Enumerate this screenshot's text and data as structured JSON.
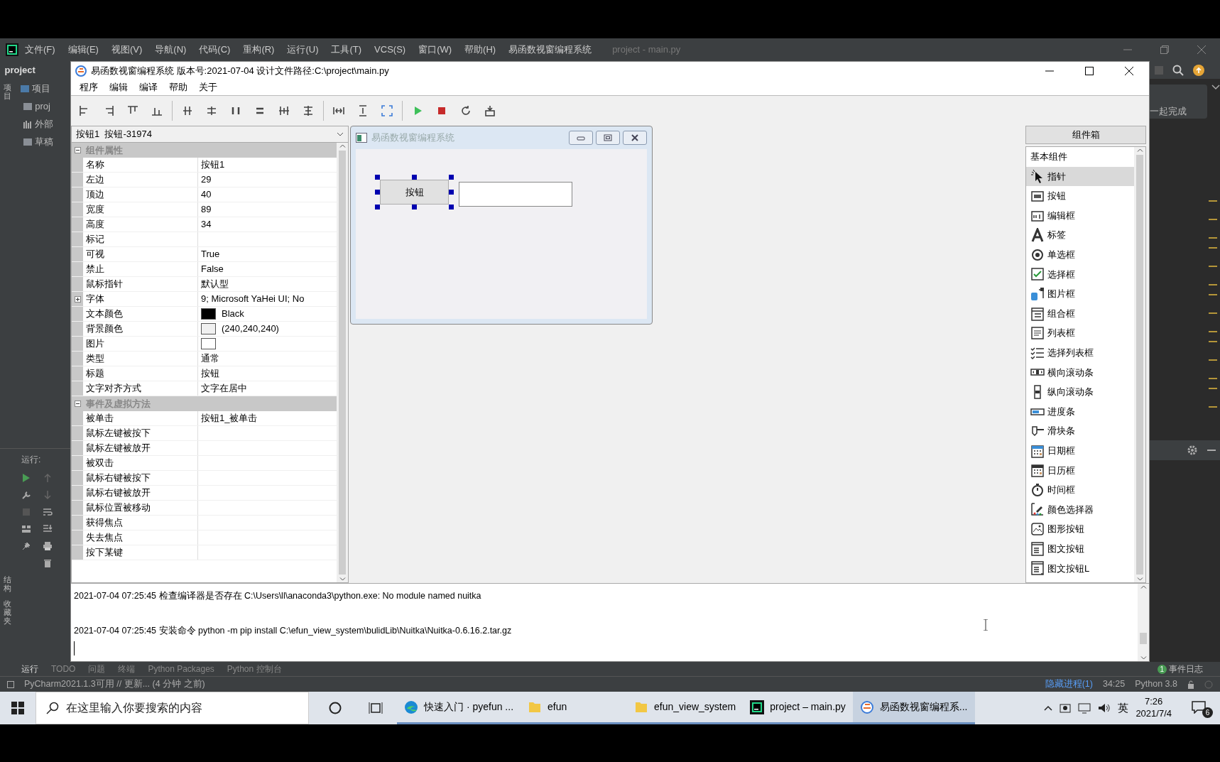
{
  "ide": {
    "menu": [
      "文件(F)",
      "编辑(E)",
      "视图(V)",
      "导航(N)",
      "代码(C)",
      "重构(R)",
      "运行(U)",
      "工具(T)",
      "VCS(S)",
      "窗口(W)",
      "帮助(H)",
      "易函数视窗编程系统"
    ],
    "project_title": "project - main.py",
    "breadcrumb": "project",
    "tool_tab": "项目",
    "tree": [
      {
        "label": "项目"
      },
      {
        "label": "proj"
      },
      {
        "label": "外部"
      },
      {
        "label": "草稿"
      }
    ],
    "run_label": "运行:",
    "side_tabs": [
      "结构",
      "收藏夹"
    ],
    "notice": "一起完成",
    "bottom_tabs": [
      {
        "label": "运行",
        "selected": true
      },
      {
        "label": "TODO",
        "selected": false
      },
      {
        "label": "问题",
        "selected": false
      },
      {
        "label": "终端",
        "selected": false
      },
      {
        "label": "Python Packages",
        "selected": false
      },
      {
        "label": "Python 控制台",
        "selected": false
      }
    ],
    "event_log": {
      "label": "事件日志",
      "count": "1"
    },
    "status": {
      "message": "PyCharm2021.1.3可用 // 更新... (4 分钟 之前)",
      "link": "隐藏进程(1)",
      "position": "34:25",
      "interpreter": "Python 3.8"
    }
  },
  "efun": {
    "title": "易函数视窗编程系统 版本号:2021-07-04 设计文件路径:C:\\project\\main.py",
    "menu": [
      "程序",
      "编辑",
      "编译",
      "帮助",
      "关于"
    ],
    "selector": "按钮1  按钮-31974",
    "properties": [
      {
        "group": "组件属性",
        "expanded": true,
        "rows": [
          {
            "name": "名称",
            "value": "按钮1",
            "kind": "text"
          },
          {
            "name": "左边",
            "value": "29",
            "kind": "text"
          },
          {
            "name": "顶边",
            "value": "40",
            "kind": "text"
          },
          {
            "name": "宽度",
            "value": "89",
            "kind": "text"
          },
          {
            "name": "高度",
            "value": "34",
            "kind": "text"
          },
          {
            "name": "标记",
            "kind": "text"
          },
          {
            "name": "可视",
            "value": "True",
            "kind": "text"
          },
          {
            "name": "禁止",
            "value": "False",
            "kind": "text"
          },
          {
            "name": "鼠标指针",
            "value": "默认型",
            "kind": "text"
          },
          {
            "name": "字体",
            "value": "9; Microsoft YaHei UI; No",
            "kind": "text",
            "expandable": true
          },
          {
            "name": "文本颜色",
            "value": "Black",
            "kind": "color",
            "color": "#000000"
          },
          {
            "name": "背景颜色",
            "value": "(240,240,240)",
            "kind": "color",
            "color": "#f0f0f0"
          },
          {
            "name": "图片",
            "kind": "image"
          },
          {
            "name": "类型",
            "value": "通常",
            "kind": "text"
          },
          {
            "name": "标题",
            "value": "按钮",
            "kind": "text"
          },
          {
            "name": "文字对齐方式",
            "value": "文字在居中",
            "kind": "text"
          }
        ]
      },
      {
        "group": "事件及虚拟方法",
        "expanded": true,
        "rows": [
          {
            "name": "被单击",
            "value": "按钮1_被单击",
            "kind": "text"
          },
          {
            "name": "鼠标左键被按下",
            "kind": "text"
          },
          {
            "name": "鼠标左键被放开",
            "kind": "text"
          },
          {
            "name": "被双击",
            "kind": "text"
          },
          {
            "name": "鼠标右键被按下",
            "kind": "text"
          },
          {
            "name": "鼠标右键被放开",
            "kind": "text"
          },
          {
            "name": "鼠标位置被移动",
            "kind": "text"
          },
          {
            "name": "获得焦点",
            "kind": "text"
          },
          {
            "name": "失去焦点",
            "kind": "text"
          },
          {
            "name": "按下某键",
            "kind": "text"
          }
        ]
      }
    ],
    "form": {
      "title": "易函数视窗编程系统",
      "button": {
        "label": "按钮",
        "selected": true
      }
    },
    "toolbox": {
      "title": "组件箱",
      "category": "基本组件",
      "items": [
        {
          "label": "指针",
          "selected": true
        },
        {
          "label": "按钮",
          "selected": false
        },
        {
          "label": "编辑框",
          "selected": false
        },
        {
          "label": "标签",
          "selected": false
        },
        {
          "label": "单选框",
          "selected": false
        },
        {
          "label": "选择框",
          "selected": false
        },
        {
          "label": "图片框",
          "selected": false
        },
        {
          "label": "组合框",
          "selected": false
        },
        {
          "label": "列表框",
          "selected": false
        },
        {
          "label": "选择列表框",
          "selected": false
        },
        {
          "label": "横向滚动条",
          "selected": false
        },
        {
          "label": "纵向滚动条",
          "selected": false
        },
        {
          "label": "进度条",
          "selected": false
        },
        {
          "label": "滑块条",
          "selected": false
        },
        {
          "label": "日期框",
          "selected": false
        },
        {
          "label": "日历框",
          "selected": false
        },
        {
          "label": "时间框",
          "selected": false
        },
        {
          "label": "颜色选择器",
          "selected": false
        },
        {
          "label": "图形按钮",
          "selected": false
        },
        {
          "label": "图文按钮",
          "selected": false
        },
        {
          "label": "图文按钮L",
          "selected": false
        }
      ]
    },
    "log": [
      "2021-07-04 07:25:45 检查编译器是否存在 C:\\Users\\ll\\anaconda3\\python.exe: No module named nuitka",
      "2021-07-04 07:25:45 安装命令 python -m pip install C:\\efun_view_system\\bulidLib\\Nuitka\\Nuitka-0.6.16.2.tar.gz"
    ]
  },
  "taskbar": {
    "search_placeholder": "在这里输入你要搜索的内容",
    "apps": [
      {
        "label": "快速入门 · pyefun ...",
        "selected": false
      },
      {
        "label": "efun",
        "selected": false
      },
      {
        "label": "efun_view_system",
        "selected": false
      },
      {
        "label": "project – main.py",
        "selected": false
      },
      {
        "label": "易函数视窗编程系...",
        "selected": true
      }
    ],
    "ime": "英",
    "time": "7:26",
    "date": "2021/7/4",
    "notifications": "6"
  }
}
